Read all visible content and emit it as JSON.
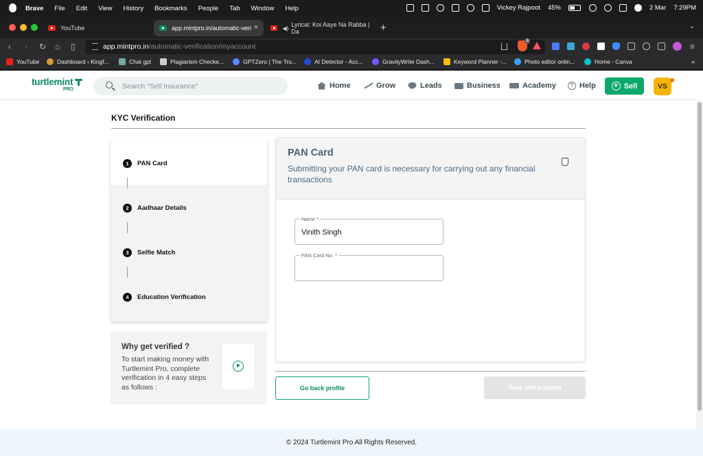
{
  "menubar": {
    "app": "Brave",
    "items": [
      "File",
      "Edit",
      "View",
      "History",
      "Bookmarks",
      "People",
      "Tab",
      "Window",
      "Help"
    ],
    "user": "Vickey Rajpoot",
    "battery": "45%",
    "date": "2 Mar",
    "time": "7:29PM"
  },
  "tabs": [
    {
      "label": "YouTube"
    },
    {
      "label": "app.mintpro.in/automatic-veri"
    },
    {
      "label": "Lyrical: Koi Aaye Na Rabba | Da"
    }
  ],
  "address": {
    "host": "app.mintpro.in",
    "path": "/automatic-verification/myaccount"
  },
  "bookmarks": [
    {
      "label": "YouTube",
      "color": "#e62117"
    },
    {
      "label": "Dashboard ‹ Kingf...",
      "color": "#d79a3a"
    },
    {
      "label": "Chat gpt",
      "color": "#74aa9c"
    },
    {
      "label": "Plagiarism Checke...",
      "color": "#cccccc"
    },
    {
      "label": "GPTZero | The Tru...",
      "color": "#5b8cff"
    },
    {
      "label": "AI Detector - Acc...",
      "color": "#1d4ed8"
    },
    {
      "label": "GravityWrite Dash...",
      "color": "#6d5dfc"
    },
    {
      "label": "Keyword Planner -...",
      "color": "#fbbc04"
    },
    {
      "label": "Photo editor onlin...",
      "color": "#3aa0ff"
    },
    {
      "label": "Home - Canva",
      "color": "#00c4cc"
    }
  ],
  "header": {
    "logo": "turtlemint",
    "logo_sub": "PRO",
    "search_placeholder": "Search \"Sell Insurance\"",
    "nav": {
      "home": "Home",
      "grow": "Grow",
      "leads": "Leads",
      "business": "Business",
      "academy": "Academy",
      "help": "Help"
    },
    "help_glyph": "?",
    "sell": "Sell",
    "sell_glyph": "+",
    "avatar": "VS"
  },
  "kyc": {
    "title": "KYC Verification",
    "steps": [
      {
        "num": "1",
        "label": "PAN Card"
      },
      {
        "num": "2",
        "label": "Aadhaar Details"
      },
      {
        "num": "3",
        "label": "Selfie Match"
      },
      {
        "num": "4",
        "label": "Education Verification"
      }
    ],
    "why_title": "Why get verified ?",
    "why_text": "To start making money with Turtlemint Pro, complete verification in 4 easy steps as follows :"
  },
  "pan": {
    "title": "PAN Card",
    "subtitle": "Submitting your PAN card is necessary for carrying out any financial transactions",
    "name_label": "Name *",
    "name_value": "Vinith Singh",
    "pan_label": "PAN Card No. *",
    "pan_value": ""
  },
  "actions": {
    "back": "Go back profile",
    "save": "Save and proceed"
  },
  "footer": "© 2024 Turtlemint Pro All Rights Reserved."
}
